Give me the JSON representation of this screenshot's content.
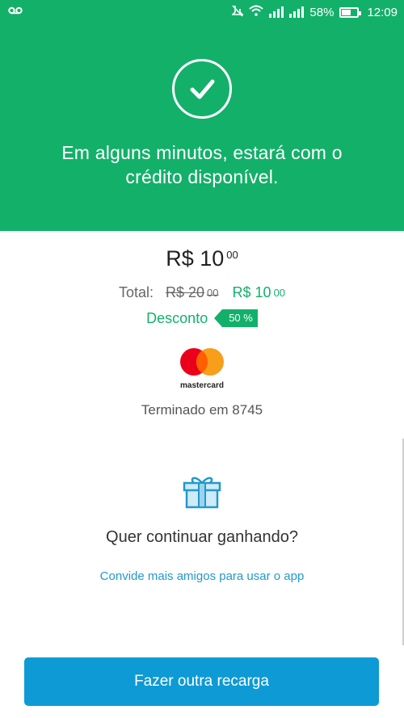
{
  "status_bar": {
    "battery": "58%",
    "time": "12:09",
    "icons": [
      "voicemail-icon",
      "mute-icon",
      "wifi-icon",
      "signal-icon",
      "signal-icon",
      "battery-icon"
    ]
  },
  "hero": {
    "icon": "check-circle-icon",
    "message": "Em alguns minutos, estará com o crédito disponível."
  },
  "summary": {
    "amount_main": "R$ 10",
    "amount_cents": "00",
    "total_label": "Total:",
    "original_main": "R$ 20",
    "original_cents": "00",
    "final_main": "R$ 10",
    "final_cents": "00",
    "discount_label": "Desconto",
    "discount_badge": "50 %"
  },
  "payment": {
    "card_brand": "mastercard",
    "card_ending": "Terminado em 8745"
  },
  "promo": {
    "icon": "gift-icon",
    "title": "Quer continuar ganhando?",
    "link": "Convide mais amigos para usar o app"
  },
  "actions": {
    "primary_button": "Fazer outra recarga"
  },
  "colors": {
    "brand_green": "#13b06a",
    "link_blue": "#2399c9",
    "button_blue": "#0d9ad5"
  }
}
